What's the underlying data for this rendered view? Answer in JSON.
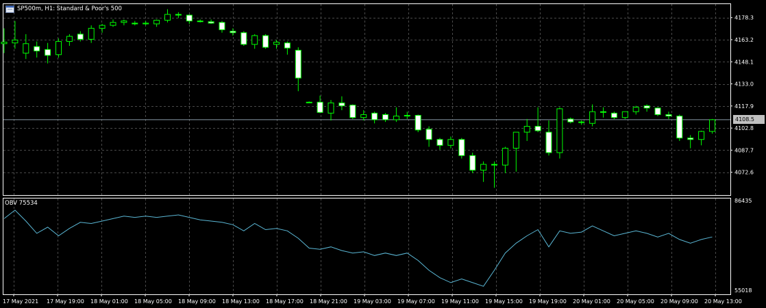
{
  "chart_header": {
    "symbol_label": "SP500m, H1:  Standard & Poor's 500",
    "window_icon": "chart-window-icon"
  },
  "current_price": "4108.5",
  "obv_label": "OBV 75534",
  "colors": {
    "background": "#000000",
    "grid": "#4a4a4a",
    "bull": "#000000",
    "bear": "#ffffff",
    "wick": "#00ff00",
    "obv_line": "#5bb8d6",
    "price_line": "#8a9ba8"
  },
  "chart_data": [
    {
      "type": "candlestick",
      "title": "SP500m, H1:  Standard & Poor's 500",
      "ylim": [
        4057,
        4188
      ],
      "y_ticks": [
        "4178.3",
        "4163.2",
        "4148.1",
        "4133.0",
        "4117.9",
        "4102.8",
        "4087.7",
        "4072.6"
      ],
      "current_price": 4108.5,
      "x_tick_labels": [
        "17 May 2021",
        "17 May 19:00",
        "18 May 01:00",
        "18 May 05:00",
        "18 May 09:00",
        "18 May 13:00",
        "18 May 17:00",
        "18 May 21:00",
        "19 May 03:00",
        "19 May 07:00",
        "19 May 11:00",
        "19 May 15:00",
        "19 May 19:00",
        "20 May 01:00",
        "20 May 05:00",
        "20 May 09:00",
        "20 May 13:00"
      ],
      "candles": [
        {
          "o": 4160.5,
          "h": 4171,
          "l": 4154,
          "c": 4161.5
        },
        {
          "o": 4161,
          "h": 4176,
          "l": 4157,
          "c": 4163
        },
        {
          "o": 4154,
          "h": 4167,
          "l": 4150,
          "c": 4160.5
        },
        {
          "o": 4158.5,
          "h": 4162,
          "l": 4151,
          "c": 4155.5
        },
        {
          "o": 4156.5,
          "h": 4161,
          "l": 4147,
          "c": 4152.5
        },
        {
          "o": 4153,
          "h": 4164,
          "l": 4151,
          "c": 4162
        },
        {
          "o": 4162,
          "h": 4167,
          "l": 4159,
          "c": 4165.5
        },
        {
          "o": 4167,
          "h": 4169,
          "l": 4162,
          "c": 4163.5
        },
        {
          "o": 4163.5,
          "h": 4173,
          "l": 4161,
          "c": 4171
        },
        {
          "o": 4171,
          "h": 4174,
          "l": 4168,
          "c": 4173
        },
        {
          "o": 4173,
          "h": 4177,
          "l": 4172,
          "c": 4175
        },
        {
          "o": 4175,
          "h": 4177,
          "l": 4173,
          "c": 4176
        },
        {
          "o": 4174.5,
          "h": 4176,
          "l": 4173,
          "c": 4174
        },
        {
          "o": 4174,
          "h": 4176,
          "l": 4173,
          "c": 4174.5
        },
        {
          "o": 4174,
          "h": 4177,
          "l": 4172,
          "c": 4176.5
        },
        {
          "o": 4176.5,
          "h": 4184,
          "l": 4175,
          "c": 4180.5
        },
        {
          "o": 4180.5,
          "h": 4182,
          "l": 4178,
          "c": 4180
        },
        {
          "o": 4180,
          "h": 4180.5,
          "l": 4174,
          "c": 4176
        },
        {
          "o": 4176,
          "h": 4177,
          "l": 4175,
          "c": 4175.5
        },
        {
          "o": 4175.5,
          "h": 4177,
          "l": 4174,
          "c": 4174.5
        },
        {
          "o": 4175,
          "h": 4176,
          "l": 4168,
          "c": 4170
        },
        {
          "o": 4169,
          "h": 4171,
          "l": 4166,
          "c": 4168
        },
        {
          "o": 4168,
          "h": 4169,
          "l": 4159,
          "c": 4160
        },
        {
          "o": 4160,
          "h": 4167,
          "l": 4157,
          "c": 4166
        },
        {
          "o": 4166,
          "h": 4167,
          "l": 4157,
          "c": 4158
        },
        {
          "o": 4160,
          "h": 4163,
          "l": 4157,
          "c": 4161.5
        },
        {
          "o": 4161,
          "h": 4162,
          "l": 4153,
          "c": 4157.5
        },
        {
          "o": 4156,
          "h": 4158,
          "l": 4128,
          "c": 4137
        },
        {
          "o": 4120.5,
          "h": 4121,
          "l": 4120,
          "c": 4120.5
        },
        {
          "o": 4120.5,
          "h": 4125,
          "l": 4113,
          "c": 4113.5
        },
        {
          "o": 4113,
          "h": 4122,
          "l": 4108,
          "c": 4120
        },
        {
          "o": 4120,
          "h": 4124.5,
          "l": 4115,
          "c": 4118
        },
        {
          "o": 4118.5,
          "h": 4119,
          "l": 4109,
          "c": 4110
        },
        {
          "o": 4110,
          "h": 4115,
          "l": 4108,
          "c": 4112
        },
        {
          "o": 4113,
          "h": 4114,
          "l": 4106,
          "c": 4108.5
        },
        {
          "o": 4112,
          "h": 4113,
          "l": 4107,
          "c": 4108.5
        },
        {
          "o": 4108.5,
          "h": 4117,
          "l": 4107,
          "c": 4111
        },
        {
          "o": 4111,
          "h": 4114,
          "l": 4109,
          "c": 4111.5
        },
        {
          "o": 4111.5,
          "h": 4112,
          "l": 4100,
          "c": 4101.5
        },
        {
          "o": 4102,
          "h": 4104,
          "l": 4090,
          "c": 4095
        },
        {
          "o": 4095,
          "h": 4096,
          "l": 4088,
          "c": 4091
        },
        {
          "o": 4091,
          "h": 4097,
          "l": 4089,
          "c": 4095
        },
        {
          "o": 4095,
          "h": 4096,
          "l": 4082,
          "c": 4084
        },
        {
          "o": 4084,
          "h": 4086,
          "l": 4072,
          "c": 4074
        },
        {
          "o": 4074,
          "h": 4080,
          "l": 4066,
          "c": 4078
        },
        {
          "o": 4078,
          "h": 4080,
          "l": 4062,
          "c": 4077.5
        },
        {
          "o": 4077.5,
          "h": 4090,
          "l": 4072,
          "c": 4089
        },
        {
          "o": 4089,
          "h": 4100,
          "l": 4073,
          "c": 4100
        },
        {
          "o": 4100,
          "h": 4109,
          "l": 4094,
          "c": 4104
        },
        {
          "o": 4104,
          "h": 4117,
          "l": 4100,
          "c": 4101
        },
        {
          "o": 4100,
          "h": 4108,
          "l": 4084,
          "c": 4086
        },
        {
          "o": 4086,
          "h": 4117,
          "l": 4082,
          "c": 4116
        },
        {
          "o": 4109,
          "h": 4110,
          "l": 4106,
          "c": 4107
        },
        {
          "o": 4107,
          "h": 4108,
          "l": 4105,
          "c": 4107
        },
        {
          "o": 4106,
          "h": 4119,
          "l": 4104,
          "c": 4114
        },
        {
          "o": 4114,
          "h": 4117,
          "l": 4110,
          "c": 4113.5
        },
        {
          "o": 4113,
          "h": 4114,
          "l": 4109,
          "c": 4110
        },
        {
          "o": 4110,
          "h": 4114,
          "l": 4109,
          "c": 4114
        },
        {
          "o": 4114,
          "h": 4118,
          "l": 4112,
          "c": 4117
        },
        {
          "o": 4118,
          "h": 4119,
          "l": 4114,
          "c": 4116.5
        },
        {
          "o": 4116.5,
          "h": 4117,
          "l": 4111,
          "c": 4112
        },
        {
          "o": 4112,
          "h": 4114,
          "l": 4109,
          "c": 4111
        },
        {
          "o": 4111,
          "h": 4112,
          "l": 4094,
          "c": 4096
        },
        {
          "o": 4096,
          "h": 4098,
          "l": 4089,
          "c": 4095
        },
        {
          "o": 4095,
          "h": 4101,
          "l": 4091,
          "c": 4100.5
        },
        {
          "o": 4100.5,
          "h": 4109,
          "l": 4099,
          "c": 4108.5
        }
      ]
    },
    {
      "type": "line",
      "title": "OBV 75534",
      "ylim": [
        55018,
        86435
      ],
      "y_ticks": [
        "86435",
        "55018"
      ],
      "series": [
        {
          "name": "OBV",
          "values": [
            83000,
            86435,
            82000,
            77000,
            79500,
            76000,
            79000,
            81500,
            81000,
            82000,
            83000,
            84000,
            83500,
            84000,
            83500,
            84000,
            84500,
            83500,
            82500,
            82000,
            81500,
            80500,
            78000,
            81000,
            78500,
            79000,
            78000,
            75000,
            71000,
            70500,
            71500,
            70000,
            69000,
            69500,
            68000,
            69000,
            68000,
            69000,
            66000,
            62000,
            59000,
            57000,
            58500,
            57000,
            55500,
            62000,
            69000,
            73000,
            76000,
            78500,
            71500,
            78000,
            77000,
            77500,
            80000,
            78000,
            76000,
            77000,
            78000,
            77000,
            75500,
            77000,
            74500,
            73000,
            74500,
            75534
          ]
        }
      ]
    }
  ]
}
